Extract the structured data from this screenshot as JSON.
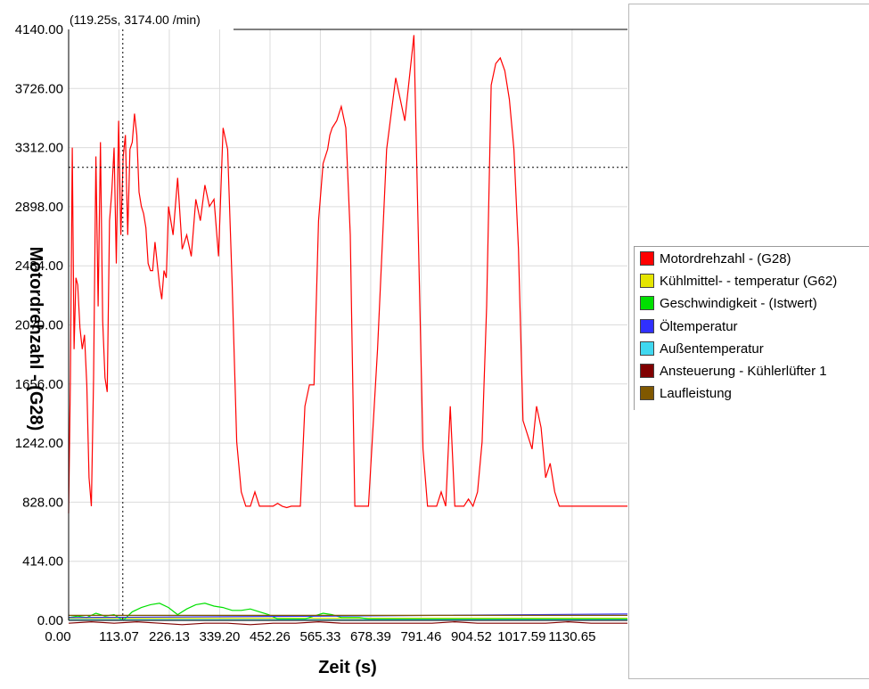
{
  "readout": "(119.25s, 3174.00 /min)",
  "cursor": {
    "x": 119.25,
    "y": 3174.0
  },
  "legend": [
    {
      "label": "Motordrehzahl - (G28)",
      "color": "#ff0000"
    },
    {
      "label": "Kühlmittel- - temperatur (G62)",
      "color": "#e5e500"
    },
    {
      "label": "Geschwindigkeit - (Istwert)",
      "color": "#00e000"
    },
    {
      "label": "Öltemperatur",
      "color": "#3030ff"
    },
    {
      "label": "Außentemperatur",
      "color": "#40d8f0"
    },
    {
      "label": "Ansteuerung - Kühlerlüfter 1",
      "color": "#800000"
    },
    {
      "label": "Laufleistung",
      "color": "#805800"
    }
  ],
  "chart_data": {
    "type": "line",
    "xlabel": "Zeit (s)",
    "ylabel": "Motordrehzahl - (G28)",
    "xlim": [
      0,
      1230
    ],
    "ylim": [
      0,
      4140
    ],
    "x_ticks": [
      "0.00",
      "113.07",
      "226.13",
      "339.20",
      "452.26",
      "565.33",
      "678.39",
      "791.46",
      "904.52",
      "1017.59",
      "1130.65"
    ],
    "y_ticks": [
      "0.00",
      "414.00",
      "828.00",
      "1242.00",
      "1656.00",
      "2070.00",
      "2484.00",
      "2898.00",
      "3312.00",
      "3726.00",
      "4140.00"
    ],
    "grid": true,
    "series": [
      {
        "name": "Motordrehzahl - (G28)",
        "color": "#ff0000",
        "x": [
          0,
          4,
          8,
          12,
          16,
          20,
          25,
          30,
          35,
          40,
          45,
          50,
          55,
          60,
          65,
          70,
          75,
          80,
          85,
          90,
          95,
          100,
          105,
          110,
          115,
          120,
          125,
          130,
          135,
          140,
          145,
          150,
          155,
          160,
          165,
          170,
          175,
          180,
          185,
          190,
          195,
          200,
          205,
          210,
          215,
          220,
          230,
          240,
          250,
          260,
          270,
          280,
          290,
          300,
          310,
          320,
          330,
          340,
          350,
          360,
          370,
          380,
          390,
          400,
          410,
          420,
          430,
          440,
          450,
          460,
          470,
          480,
          490,
          500,
          510,
          520,
          530,
          540,
          550,
          560,
          570,
          575,
          580,
          590,
          600,
          610,
          620,
          630,
          640,
          650,
          660,
          680,
          700,
          720,
          740,
          760,
          780,
          790,
          800,
          810,
          820,
          830,
          840,
          850,
          860,
          870,
          880,
          890,
          900,
          910,
          920,
          930,
          940,
          950,
          960,
          970,
          980,
          990,
          1000,
          1010,
          1020,
          1030,
          1040,
          1050,
          1060,
          1070,
          1080,
          1090,
          1100,
          1110,
          1120,
          1130,
          1140,
          1150,
          1160,
          1170,
          1180,
          1190,
          1200,
          1210,
          1220,
          1230
        ],
        "y": [
          750,
          1700,
          3312,
          1900,
          2400,
          2350,
          2050,
          1900,
          2000,
          1650,
          1000,
          800,
          1700,
          3250,
          2200,
          3350,
          2100,
          1700,
          1600,
          2800,
          3000,
          3312,
          2500,
          3500,
          2700,
          3250,
          3400,
          2700,
          3300,
          3350,
          3550,
          3400,
          3000,
          2900,
          2850,
          2750,
          2500,
          2450,
          2450,
          2650,
          2500,
          2350,
          2250,
          2450,
          2400,
          2900,
          2700,
          3100,
          2600,
          2700,
          2550,
          2950,
          2800,
          3050,
          2900,
          2950,
          2550,
          3450,
          3300,
          2350,
          1250,
          900,
          800,
          800,
          900,
          800,
          800,
          800,
          800,
          820,
          800,
          790,
          800,
          800,
          800,
          1500,
          1650,
          1650,
          2800,
          3200,
          3300,
          3400,
          3450,
          3500,
          3600,
          3450,
          2700,
          800,
          800,
          800,
          800,
          1900,
          3300,
          3800,
          3500,
          4100,
          1200,
          800,
          800,
          800,
          900,
          800,
          1500,
          800,
          800,
          800,
          850,
          800,
          900,
          1250,
          2200,
          3750,
          3900,
          3940,
          3850,
          3650,
          3300,
          2600,
          1400,
          1300,
          1200,
          1500,
          1350,
          1000,
          1100,
          900,
          800,
          800,
          800,
          800,
          800,
          800,
          800,
          800,
          800,
          800,
          800,
          800,
          800,
          800,
          800,
          800
        ]
      },
      {
        "name": "Kühlmittel- - temperatur (G62)",
        "color": "#e5e500",
        "x": [
          0,
          1230
        ],
        "y": [
          15,
          15
        ]
      },
      {
        "name": "Geschwindigkeit - (Istwert)",
        "color": "#00e000",
        "x": [
          0,
          20,
          40,
          60,
          80,
          100,
          120,
          140,
          160,
          180,
          200,
          220,
          240,
          260,
          280,
          300,
          320,
          340,
          360,
          380,
          400,
          420,
          440,
          460,
          480,
          500,
          520,
          540,
          560,
          580,
          600,
          620,
          640,
          660,
          680,
          700,
          720,
          740,
          760,
          780,
          800,
          820,
          840,
          860,
          880,
          900,
          920,
          940,
          960,
          980,
          1000,
          1020,
          1040,
          1060,
          1080,
          1100,
          1120,
          1140,
          1160,
          1180,
          1200,
          1230
        ],
        "y": [
          20,
          30,
          20,
          50,
          30,
          40,
          0,
          60,
          90,
          110,
          120,
          90,
          40,
          80,
          110,
          120,
          100,
          90,
          70,
          70,
          80,
          60,
          40,
          10,
          10,
          10,
          10,
          30,
          50,
          40,
          20,
          20,
          20,
          10,
          10,
          10,
          10,
          10,
          10,
          10,
          10,
          10,
          10,
          10,
          10,
          10,
          10,
          10,
          10,
          10,
          10,
          10,
          10,
          10,
          10,
          10,
          10,
          10,
          10,
          10,
          10,
          10
        ]
      },
      {
        "name": "Öltemperatur",
        "color": "#3030ff",
        "x": [
          0,
          600,
          1230
        ],
        "y": [
          20,
          30,
          45
        ]
      },
      {
        "name": "Außentemperatur",
        "color": "#40d8f0",
        "x": [
          0,
          1230
        ],
        "y": [
          5,
          5
        ]
      },
      {
        "name": "Ansteuerung - Kühlerlüfter 1",
        "color": "#800000",
        "x": [
          0,
          50,
          100,
          150,
          200,
          250,
          300,
          350,
          400,
          450,
          500,
          550,
          600,
          650,
          700,
          750,
          800,
          850,
          900,
          950,
          1000,
          1050,
          1100,
          1150,
          1200,
          1230
        ],
        "y": [
          -20,
          -10,
          -20,
          -10,
          -20,
          -30,
          -20,
          -20,
          -30,
          -20,
          -20,
          -10,
          -20,
          -20,
          -20,
          -20,
          -20,
          -10,
          -20,
          -20,
          -20,
          -20,
          -10,
          -20,
          -20,
          -20
        ]
      },
      {
        "name": "Laufleistung",
        "color": "#805800",
        "x": [
          0,
          1230
        ],
        "y": [
          35,
          35
        ]
      }
    ]
  }
}
